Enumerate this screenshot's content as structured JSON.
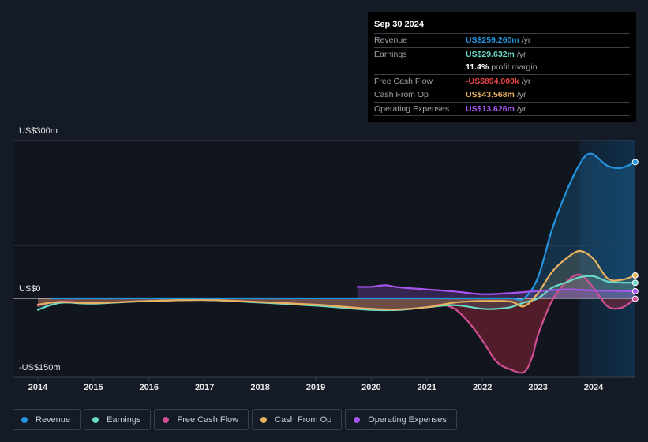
{
  "tooltip": {
    "date": "Sep 30 2024",
    "rows": [
      {
        "label": "Revenue",
        "value": "US$259.260m",
        "unit": "/yr",
        "color": "#2394df"
      },
      {
        "label": "Earnings",
        "value": "US$29.632m",
        "unit": "/yr",
        "color": "#6ad9c8"
      },
      {
        "label": "",
        "value": "11.4%",
        "unit": "profit margin",
        "color": "#ffffff"
      },
      {
        "label": "Free Cash Flow",
        "value": "-US$894.000k",
        "unit": "/yr",
        "color": "#e84545"
      },
      {
        "label": "Cash From Op",
        "value": "US$43.568m",
        "unit": "/yr",
        "color": "#e8b15f"
      },
      {
        "label": "Operating Expenses",
        "value": "US$13.626m",
        "unit": "/yr",
        "color": "#a855f0"
      }
    ]
  },
  "legend": [
    {
      "label": "Revenue",
      "color": "#2394df"
    },
    {
      "label": "Earnings",
      "color": "#6ad9c8"
    },
    {
      "label": "Free Cash Flow",
      "color": "#d14f92"
    },
    {
      "label": "Cash From Op",
      "color": "#e8b15f"
    },
    {
      "label": "Operating Expenses",
      "color": "#a855f0"
    }
  ],
  "chart_data": {
    "type": "line",
    "title": "",
    "xlabel": "",
    "ylabel": "",
    "y_tick_labels": [
      "US$300m",
      "US$0",
      "-US$150m"
    ],
    "y_ticks": [
      300,
      0,
      -150
    ],
    "ylim": [
      -150,
      300
    ],
    "x_tick_labels": [
      "2014",
      "2015",
      "2016",
      "2017",
      "2018",
      "2019",
      "2020",
      "2021",
      "2022",
      "2023",
      "2024"
    ],
    "xlim": [
      2013.55,
      2024.75
    ],
    "highlight_range": [
      2023.75,
      2024.75
    ],
    "grid": true,
    "legend_position": "bottom",
    "series": [
      {
        "name": "Revenue",
        "color": "#2394df",
        "x": [
          2014.25,
          2015,
          2016,
          2017,
          2018,
          2019,
          2020,
          2021,
          2021.5,
          2022,
          2022.5,
          2022.75,
          2023,
          2023.25,
          2023.5,
          2023.75,
          2023.95,
          2024.25,
          2024.5,
          2024.75
        ],
        "y": [
          0,
          0,
          0,
          0,
          0,
          0,
          0,
          0,
          0,
          0,
          0,
          0,
          40,
          130,
          200,
          255,
          275,
          252,
          248,
          259
        ]
      },
      {
        "name": "Earnings",
        "color": "#6ad9c8",
        "x": [
          2014,
          2014.25,
          2014.5,
          2015,
          2016,
          2017,
          2018,
          2019,
          2019.5,
          2020,
          2020.5,
          2021,
          2021.5,
          2022,
          2022.25,
          2022.5,
          2022.75,
          2023,
          2023.25,
          2023.5,
          2023.75,
          2024,
          2024.25,
          2024.5,
          2024.75
        ],
        "y": [
          -22,
          -12,
          -8,
          -10,
          -5,
          -3,
          -8,
          -14,
          -18,
          -22,
          -22,
          -17,
          -13,
          -20,
          -20,
          -17,
          -8,
          0,
          20,
          30,
          40,
          42,
          32,
          30,
          29.6
        ]
      },
      {
        "name": "Free Cash Flow",
        "color": "#d14f92",
        "x": [
          2014,
          2014.25,
          2014.5,
          2015,
          2016,
          2017,
          2018,
          2019,
          2019.5,
          2020,
          2020.5,
          2021,
          2021.25,
          2021.5,
          2021.75,
          2022,
          2022.25,
          2022.5,
          2022.75,
          2022.9,
          2023,
          2023.25,
          2023.5,
          2023.75,
          2024,
          2024.25,
          2024.5,
          2024.75
        ],
        "y": [
          -14,
          -8,
          -6,
          -9,
          -5,
          -3,
          -7,
          -12,
          -16,
          -20,
          -21,
          -17,
          -12,
          -20,
          -45,
          -80,
          -120,
          -135,
          -140,
          -110,
          -70,
          -5,
          30,
          45,
          20,
          -15,
          -18,
          -0.9
        ]
      },
      {
        "name": "Cash From Op",
        "color": "#e8b15f",
        "x": [
          2014,
          2014.25,
          2014.5,
          2015,
          2016,
          2017,
          2018,
          2019,
          2019.5,
          2020,
          2020.5,
          2021,
          2021.5,
          2022,
          2022.5,
          2022.75,
          2023,
          2023.25,
          2023.5,
          2023.75,
          2024,
          2024.25,
          2024.5,
          2024.75
        ],
        "y": [
          -12,
          -8,
          -7,
          -9,
          -5,
          -3,
          -7,
          -12,
          -16,
          -20,
          -21,
          -17,
          -8,
          -5,
          -6,
          -15,
          10,
          50,
          75,
          90,
          75,
          38,
          35,
          43.6
        ]
      },
      {
        "name": "Operating Expenses",
        "color": "#a855f0",
        "x": [
          2019.75,
          2020,
          2020.25,
          2020.5,
          2021,
          2021.5,
          2022,
          2022.5,
          2023,
          2023.5,
          2024,
          2024.5,
          2024.75
        ],
        "y": [
          22,
          22,
          25,
          21,
          17,
          13,
          8,
          10,
          14,
          17,
          15,
          14,
          13.6
        ]
      }
    ]
  }
}
